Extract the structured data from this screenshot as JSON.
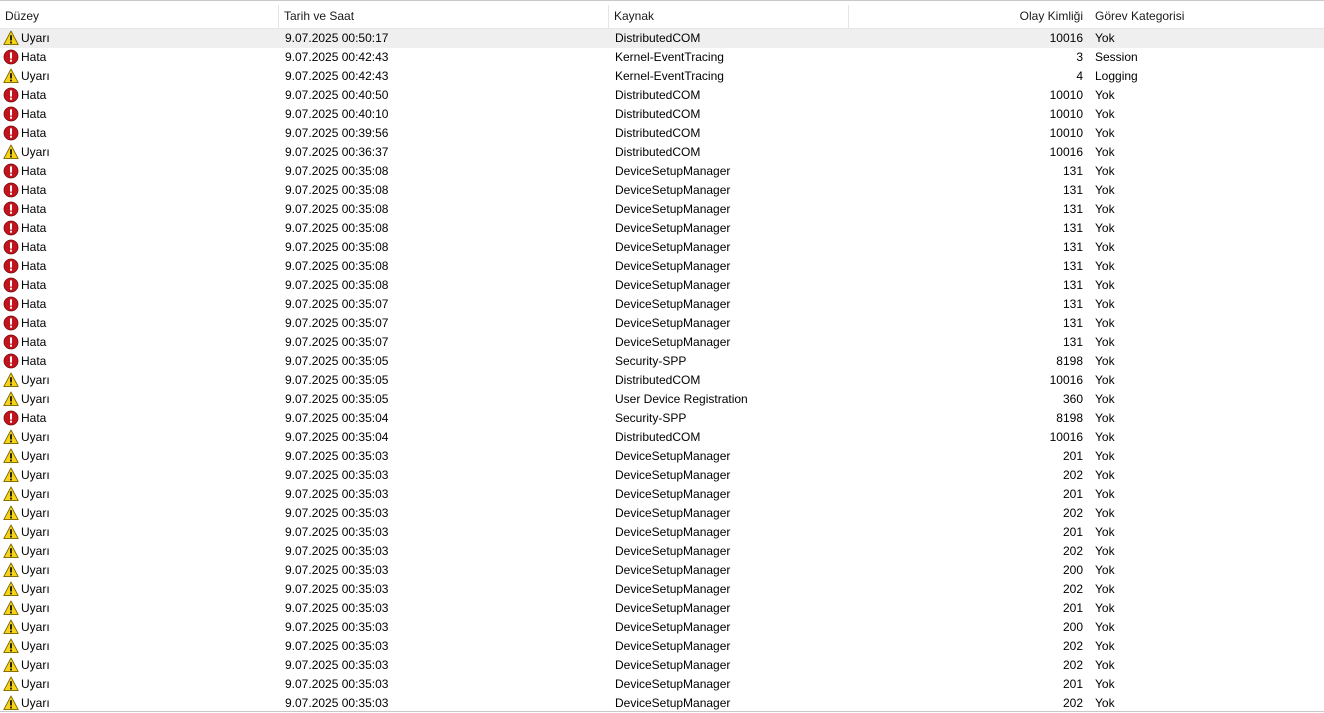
{
  "columns": {
    "level": "Düzey",
    "datetime": "Tarih ve Saat",
    "source": "Kaynak",
    "event_id": "Olay Kimliği",
    "task_category": "Görev Kategorisi"
  },
  "icons": {
    "Uyarı": "warning-icon",
    "Hata": "error-icon"
  },
  "colors": {
    "warning_fill": "#f7d417",
    "warning_stroke": "#7a6400",
    "error_fill": "#c2141d",
    "selected_row": "#efefef"
  },
  "events": [
    {
      "level": "Uyarı",
      "datetime": "9.07.2025 00:50:17",
      "source": "DistributedCOM",
      "event_id": "10016",
      "task": "Yok",
      "selected": true
    },
    {
      "level": "Hata",
      "datetime": "9.07.2025 00:42:43",
      "source": "Kernel-EventTracing",
      "event_id": "3",
      "task": "Session"
    },
    {
      "level": "Uyarı",
      "datetime": "9.07.2025 00:42:43",
      "source": "Kernel-EventTracing",
      "event_id": "4",
      "task": "Logging"
    },
    {
      "level": "Hata",
      "datetime": "9.07.2025 00:40:50",
      "source": "DistributedCOM",
      "event_id": "10010",
      "task": "Yok"
    },
    {
      "level": "Hata",
      "datetime": "9.07.2025 00:40:10",
      "source": "DistributedCOM",
      "event_id": "10010",
      "task": "Yok"
    },
    {
      "level": "Hata",
      "datetime": "9.07.2025 00:39:56",
      "source": "DistributedCOM",
      "event_id": "10010",
      "task": "Yok"
    },
    {
      "level": "Uyarı",
      "datetime": "9.07.2025 00:36:37",
      "source": "DistributedCOM",
      "event_id": "10016",
      "task": "Yok"
    },
    {
      "level": "Hata",
      "datetime": "9.07.2025 00:35:08",
      "source": "DeviceSetupManager",
      "event_id": "131",
      "task": "Yok"
    },
    {
      "level": "Hata",
      "datetime": "9.07.2025 00:35:08",
      "source": "DeviceSetupManager",
      "event_id": "131",
      "task": "Yok"
    },
    {
      "level": "Hata",
      "datetime": "9.07.2025 00:35:08",
      "source": "DeviceSetupManager",
      "event_id": "131",
      "task": "Yok"
    },
    {
      "level": "Hata",
      "datetime": "9.07.2025 00:35:08",
      "source": "DeviceSetupManager",
      "event_id": "131",
      "task": "Yok"
    },
    {
      "level": "Hata",
      "datetime": "9.07.2025 00:35:08",
      "source": "DeviceSetupManager",
      "event_id": "131",
      "task": "Yok"
    },
    {
      "level": "Hata",
      "datetime": "9.07.2025 00:35:08",
      "source": "DeviceSetupManager",
      "event_id": "131",
      "task": "Yok"
    },
    {
      "level": "Hata",
      "datetime": "9.07.2025 00:35:08",
      "source": "DeviceSetupManager",
      "event_id": "131",
      "task": "Yok"
    },
    {
      "level": "Hata",
      "datetime": "9.07.2025 00:35:07",
      "source": "DeviceSetupManager",
      "event_id": "131",
      "task": "Yok"
    },
    {
      "level": "Hata",
      "datetime": "9.07.2025 00:35:07",
      "source": "DeviceSetupManager",
      "event_id": "131",
      "task": "Yok"
    },
    {
      "level": "Hata",
      "datetime": "9.07.2025 00:35:07",
      "source": "DeviceSetupManager",
      "event_id": "131",
      "task": "Yok"
    },
    {
      "level": "Hata",
      "datetime": "9.07.2025 00:35:05",
      "source": "Security-SPP",
      "event_id": "8198",
      "task": "Yok"
    },
    {
      "level": "Uyarı",
      "datetime": "9.07.2025 00:35:05",
      "source": "DistributedCOM",
      "event_id": "10016",
      "task": "Yok"
    },
    {
      "level": "Uyarı",
      "datetime": "9.07.2025 00:35:05",
      "source": "User Device Registration",
      "event_id": "360",
      "task": "Yok"
    },
    {
      "level": "Hata",
      "datetime": "9.07.2025 00:35:04",
      "source": "Security-SPP",
      "event_id": "8198",
      "task": "Yok"
    },
    {
      "level": "Uyarı",
      "datetime": "9.07.2025 00:35:04",
      "source": "DistributedCOM",
      "event_id": "10016",
      "task": "Yok"
    },
    {
      "level": "Uyarı",
      "datetime": "9.07.2025 00:35:03",
      "source": "DeviceSetupManager",
      "event_id": "201",
      "task": "Yok"
    },
    {
      "level": "Uyarı",
      "datetime": "9.07.2025 00:35:03",
      "source": "DeviceSetupManager",
      "event_id": "202",
      "task": "Yok"
    },
    {
      "level": "Uyarı",
      "datetime": "9.07.2025 00:35:03",
      "source": "DeviceSetupManager",
      "event_id": "201",
      "task": "Yok"
    },
    {
      "level": "Uyarı",
      "datetime": "9.07.2025 00:35:03",
      "source": "DeviceSetupManager",
      "event_id": "202",
      "task": "Yok"
    },
    {
      "level": "Uyarı",
      "datetime": "9.07.2025 00:35:03",
      "source": "DeviceSetupManager",
      "event_id": "201",
      "task": "Yok"
    },
    {
      "level": "Uyarı",
      "datetime": "9.07.2025 00:35:03",
      "source": "DeviceSetupManager",
      "event_id": "202",
      "task": "Yok"
    },
    {
      "level": "Uyarı",
      "datetime": "9.07.2025 00:35:03",
      "source": "DeviceSetupManager",
      "event_id": "200",
      "task": "Yok"
    },
    {
      "level": "Uyarı",
      "datetime": "9.07.2025 00:35:03",
      "source": "DeviceSetupManager",
      "event_id": "202",
      "task": "Yok"
    },
    {
      "level": "Uyarı",
      "datetime": "9.07.2025 00:35:03",
      "source": "DeviceSetupManager",
      "event_id": "201",
      "task": "Yok"
    },
    {
      "level": "Uyarı",
      "datetime": "9.07.2025 00:35:03",
      "source": "DeviceSetupManager",
      "event_id": "200",
      "task": "Yok"
    },
    {
      "level": "Uyarı",
      "datetime": "9.07.2025 00:35:03",
      "source": "DeviceSetupManager",
      "event_id": "202",
      "task": "Yok"
    },
    {
      "level": "Uyarı",
      "datetime": "9.07.2025 00:35:03",
      "source": "DeviceSetupManager",
      "event_id": "202",
      "task": "Yok"
    },
    {
      "level": "Uyarı",
      "datetime": "9.07.2025 00:35:03",
      "source": "DeviceSetupManager",
      "event_id": "201",
      "task": "Yok"
    },
    {
      "level": "Uyarı",
      "datetime": "9.07.2025 00:35:03",
      "source": "DeviceSetupManager",
      "event_id": "202",
      "task": "Yok"
    }
  ]
}
